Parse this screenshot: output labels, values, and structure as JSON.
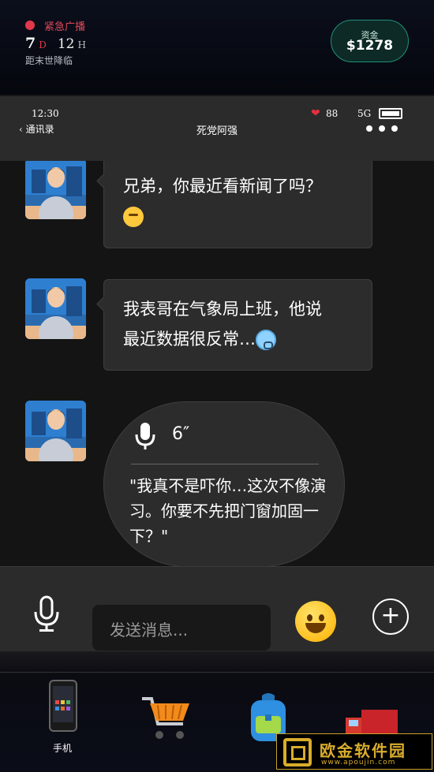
{
  "hud": {
    "alert_label": "紧急广播",
    "days": "7",
    "days_unit": "D",
    "hours": "12",
    "hours_unit": "H",
    "countdown_caption": "距末世降临",
    "money_label": "资金",
    "money_value": "$1278"
  },
  "phone": {
    "time": "12:30",
    "back_label": "通讯录",
    "contact_name": "死党阿强",
    "health": "88",
    "network": "5G"
  },
  "messages": [
    {
      "text": "兄弟，你最近看新闻了吗？",
      "emoji": "thinking-face-emoji"
    },
    {
      "text_line1": "我表哥在气象局上班，他说",
      "text_line2": "最近数据很反常…",
      "emoji": "fearful-face-emoji"
    }
  ],
  "voice_message": {
    "duration": "6″",
    "transcript": "\"我真不是吓你…这次不像演习。你要不先把门窗加固一下？\""
  },
  "input": {
    "placeholder": "发送消息..."
  },
  "dock": {
    "items": [
      {
        "label": "手机",
        "icon": "phone-icon"
      },
      {
        "label": "",
        "icon": "shopping-cart-icon"
      },
      {
        "label": "",
        "icon": "backpack-icon"
      },
      {
        "label": "",
        "icon": "truck-icon"
      }
    ]
  },
  "watermark": {
    "text": "欧金软件园",
    "url": "www.apoujin.com"
  },
  "colors": {
    "alert_red": "#e3384b",
    "money_green": "#1f8f7a",
    "heart_red": "#e2313f",
    "watermark_gold": "#d9ad2c"
  }
}
